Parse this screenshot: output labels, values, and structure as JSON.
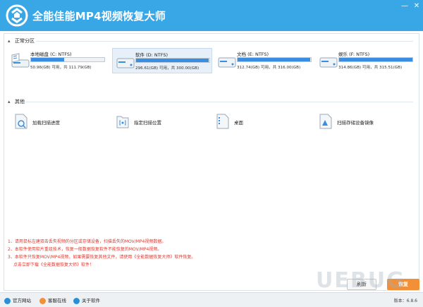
{
  "app": {
    "title": "全能佳能MP4视频恢复大师"
  },
  "window": {
    "minimize": "—",
    "close": "✕"
  },
  "partitions": {
    "header": "正常分区",
    "drives": [
      {
        "name": "本地磁盘 (C: NTFS)",
        "usage": "50.96(GB) 可用，共 111.79(GB)",
        "free_fraction": 0.456,
        "selected": false
      },
      {
        "name": "软件 (D: NTFS)",
        "usage": "296.61(GB) 可用，共 300.00(GB)",
        "free_fraction": 0.989,
        "selected": true
      },
      {
        "name": "文档 (E: NTFS)",
        "usage": "312.74(GB) 可用，共 316.00(GB)",
        "free_fraction": 0.99,
        "selected": false
      },
      {
        "name": "娱乐 (F: NTFS)",
        "usage": "314.86(GB) 可用，共 315.51(GB)",
        "free_fraction": 0.998,
        "selected": false
      }
    ]
  },
  "others": {
    "header": "其他",
    "items": [
      {
        "label": "加载扫描进度",
        "icon": "load-progress-icon"
      },
      {
        "label": "指定扫描位置",
        "icon": "scan-location-icon"
      },
      {
        "label": "桌面",
        "icon": "desktop-icon"
      },
      {
        "label": "扫描存储设备镜像",
        "icon": "device-image-icon"
      }
    ]
  },
  "notes": [
    "1、请用鼠标左建双击丢失视频的分区或存储设备，扫描丢失的MOV/MP4视频数据。",
    "2、本软件使用软片重组技术，恢复一般数据恢复软件不能恢复的MOV/MP4视频。",
    "3、本软件只恢复MOV/MP4视频，如果需要恢复其他文件，请使用《全能数据恢复大师》软件恢复。",
    "点击立即下载《全能数据恢复大师》软件！"
  ],
  "buttons": {
    "refresh": "刷新",
    "recover": "恢复"
  },
  "footer": {
    "links": [
      "官方网站",
      "客服在线",
      "关于软件"
    ],
    "version": "版本：6.8.6"
  },
  "watermark": "UEBUG",
  "colors": {
    "titlebar": "#39a7e6",
    "accent": "#3a8ee0",
    "note": "#e0362c",
    "recover_button": "#f29037"
  }
}
